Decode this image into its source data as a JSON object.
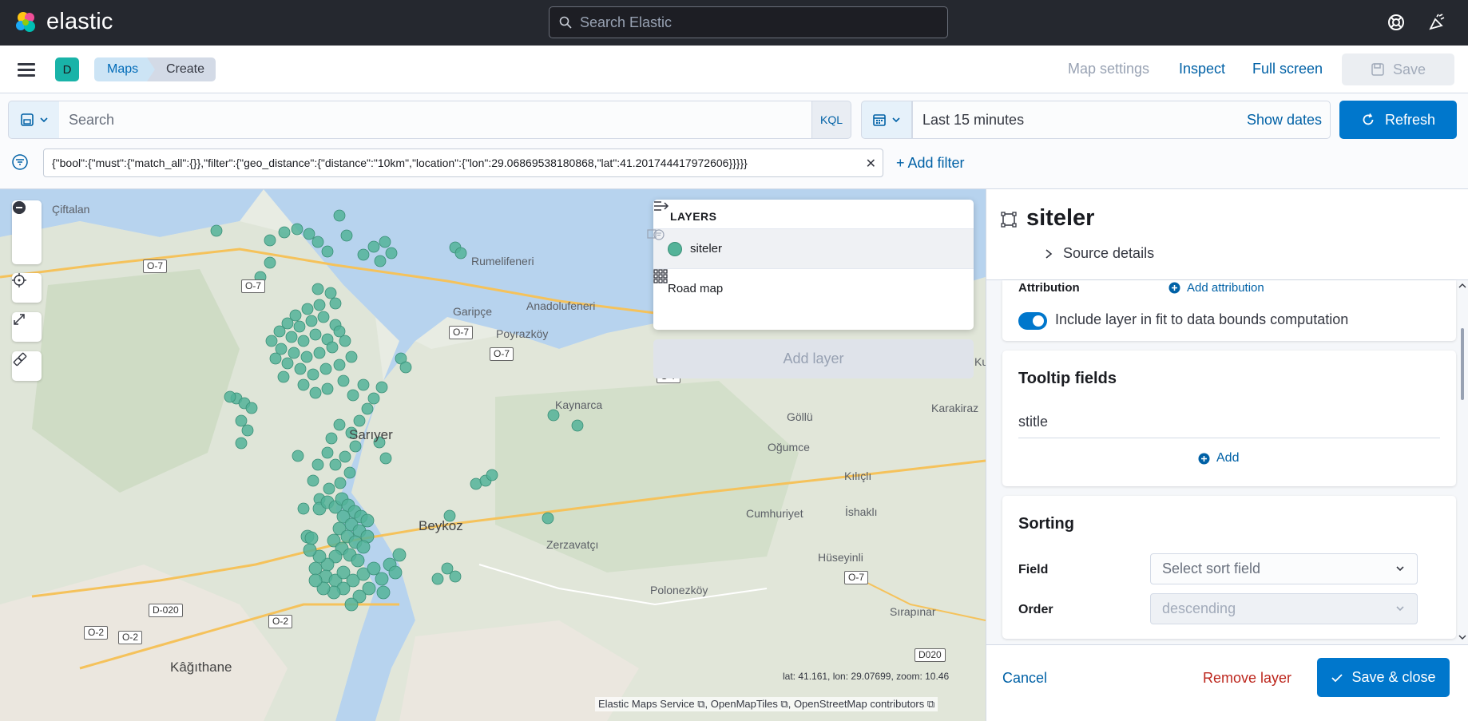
{
  "header": {
    "brand": "elastic",
    "search_placeholder": "Search Elastic"
  },
  "nav": {
    "space_initial": "D",
    "breadcrumbs": [
      "Maps",
      "Create"
    ],
    "links": {
      "map_settings": "Map settings",
      "inspect": "Inspect",
      "full_screen": "Full screen",
      "save": "Save"
    }
  },
  "query": {
    "search_placeholder": "Search",
    "language": "KQL",
    "time_range": "Last 15 minutes",
    "show_dates": "Show dates",
    "refresh": "Refresh"
  },
  "filters": {
    "active_filter": "{\"bool\":{\"must\":{\"match_all\":{}},\"filter\":{\"geo_distance\":{\"distance\":\"10km\",\"location\":{\"lon\":29.06869538180868,\"lat\":41.201744417972606}}}}}",
    "add_filter": "+ Add filter"
  },
  "map": {
    "places": [
      "Çiftalan",
      "Rumelifeneri",
      "Garipçe",
      "Anadolufeneri",
      "Poyrazköy",
      "Kaynarca",
      "Sarıyer",
      "Göllü",
      "Karakiraz",
      "Oğumce",
      "Kılıçlı",
      "İshaklı",
      "Beykoz",
      "Zerzavatçı",
      "Cumhuriyet",
      "Hüseyinli",
      "Polonezköy",
      "Sırapınar",
      "Kâğıthane",
      "Ku"
    ],
    "roads": [
      "O-7",
      "O-7",
      "O-7",
      "O-7",
      "O-7",
      "O-7",
      "D-020",
      "O-2",
      "O-2",
      "O-2",
      "D020"
    ],
    "coords_readout": "lat: 41.161, lon: 29.07699, zoom: 10.46",
    "attribution": "Elastic Maps Service ⧉, OpenMapTiles ⧉, OpenStreetMap contributors ⧉",
    "point_color": "#54b399"
  },
  "layers": {
    "title": "LAYERS",
    "items": [
      {
        "name": "siteler",
        "selected": true
      },
      {
        "name": "Road map",
        "selected": false
      }
    ],
    "add_layer": "Add layer"
  },
  "editor": {
    "layer_name": "siteler",
    "source_details": "Source details",
    "attribution_label": "Attribution",
    "add_attribution": "Add attribution",
    "fit_bounds_label": "Include layer in fit to data bounds computation",
    "tooltip": {
      "title": "Tooltip fields",
      "fields": [
        "stitle"
      ],
      "add": "Add"
    },
    "sorting": {
      "title": "Sorting",
      "field_label": "Field",
      "field_placeholder": "Select sort field",
      "order_label": "Order",
      "order_value": "descending"
    },
    "footer": {
      "cancel": "Cancel",
      "remove": "Remove layer",
      "save_close": "Save & close"
    }
  }
}
